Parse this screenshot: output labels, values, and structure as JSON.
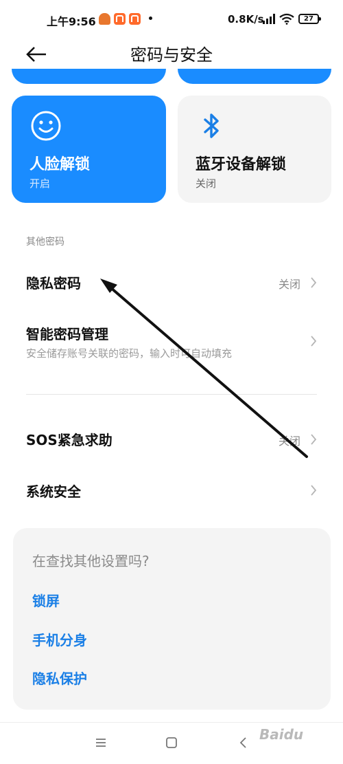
{
  "status_bar": {
    "time": "上午9:56",
    "network_speed": "0.8K/s",
    "battery": "27",
    "icons": [
      "app-icon",
      "mi-icon",
      "mi-icon",
      "signal-icon",
      "wifi-icon",
      "battery-icon"
    ]
  },
  "header": {
    "title": "密码与安全",
    "back_icon": "back-arrow-icon"
  },
  "unlock_cards": [
    {
      "title": "人脸解锁",
      "status": "开启",
      "icon": "smiley-face-icon",
      "active": true
    },
    {
      "title": "蓝牙设备解锁",
      "status": "关闭",
      "icon": "bluetooth-icon",
      "active": false
    }
  ],
  "other_passwords": {
    "section_label": "其他密码",
    "items": [
      {
        "title": "隐私密码",
        "value": "关闭"
      },
      {
        "title": "智能密码管理",
        "subtitle": "安全储存账号关联的密码，输入时可自动填充"
      }
    ]
  },
  "more_items": [
    {
      "title": "SOS紧急求助",
      "value": "关闭"
    },
    {
      "title": "系统安全"
    }
  ],
  "suggestions": {
    "question": "在查找其他设置吗?",
    "links": [
      "锁屏",
      "手机分身",
      "隐私保护"
    ]
  },
  "navbar": {
    "icons": [
      "menu-icon",
      "home-icon",
      "back-icon"
    ]
  },
  "watermark": "Baidu",
  "colors": {
    "accent": "#1a8cff",
    "link": "#1a7fe6",
    "card_bg": "#f4f4f4"
  }
}
